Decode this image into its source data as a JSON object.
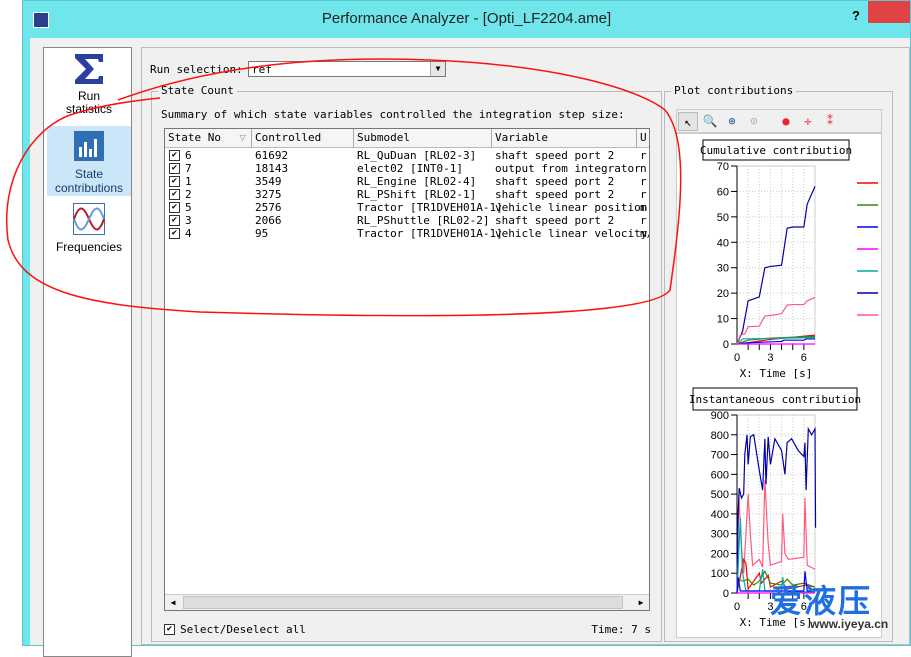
{
  "window": {
    "title": "Performance Analyzer - [Opti_LF2204.ame]",
    "help": "?"
  },
  "sidebar": {
    "items": [
      {
        "label_lines": [
          "Run",
          "statistics"
        ],
        "icon": "sigma-icon",
        "selected": false
      },
      {
        "label_lines": [
          "State",
          "contributions"
        ],
        "icon": "bar-chart-icon",
        "selected": true
      },
      {
        "label_lines": [
          "Frequencies"
        ],
        "icon": "waveform-icon",
        "selected": false
      }
    ]
  },
  "run_selection": {
    "label": "Run selection:",
    "value": "ref"
  },
  "state_count": {
    "group_title": "State Count",
    "summary": "Summary of which state variables controlled the integration step size:",
    "columns": [
      "State No",
      "Controlled",
      "Submodel",
      "Variable",
      "U"
    ],
    "rows": [
      {
        "checked": true,
        "state_no": "6",
        "controlled": "61692",
        "submodel": "RL_QuDuan [RL02-3]",
        "variable": "shaft speed port 2",
        "unit": "r"
      },
      {
        "checked": true,
        "state_no": "7",
        "controlled": "18143",
        "submodel": "elect02 [INT0-1]",
        "variable": "output from integrator",
        "unit": "n"
      },
      {
        "checked": true,
        "state_no": "1",
        "controlled": "3549",
        "submodel": "RL_Engine [RL02-4]",
        "variable": "shaft speed port 2",
        "unit": "r"
      },
      {
        "checked": true,
        "state_no": "2",
        "controlled": "3275",
        "submodel": "RL_PShift [RL02-1]",
        "variable": "shaft speed port 2",
        "unit": "r"
      },
      {
        "checked": true,
        "state_no": "5",
        "controlled": "2576",
        "submodel": "Tractor [TR1DVEH01A-1]",
        "variable": "vehicle linear position",
        "unit": "m"
      },
      {
        "checked": true,
        "state_no": "3",
        "controlled": "2066",
        "submodel": "RL_PShuttle [RL02-2]",
        "variable": "shaft speed port 2",
        "unit": "r"
      },
      {
        "checked": true,
        "state_no": "4",
        "controlled": "95",
        "submodel": "Tractor [TR1DVEH01A-1]",
        "variable": "vehicle linear velocity",
        "unit": "m/"
      }
    ],
    "select_all_label": "Select/Deselect all",
    "select_all_checked": true,
    "time_label": "Time: 7 s"
  },
  "plot": {
    "group_title": "Plot contributions",
    "toolbar": [
      "pointer-icon",
      "zoom-icon",
      "zoom-fit-icon",
      "zoom-reset-icon",
      "marker-icon",
      "crosshair-marker-icon",
      "double-marker-icon"
    ]
  },
  "chart_data": [
    {
      "type": "line",
      "title": "Cumulative contribution",
      "xlabel": "X: Time [s]",
      "xlim": [
        0,
        7
      ],
      "ylim": [
        0,
        70
      ],
      "xticks": [
        "0",
        "3",
        "6"
      ],
      "yticks": [
        "0",
        "10",
        "20",
        "30",
        "40",
        "50",
        "60",
        "70"
      ],
      "grid": true,
      "series": [
        {
          "color": "#ff0000",
          "points": [
            [
              0,
              0
            ],
            [
              1,
              0.5
            ],
            [
              3,
              1.8
            ],
            [
              7,
              3.5
            ]
          ]
        },
        {
          "color": "#3a8a00",
          "points": [
            [
              0,
              0
            ],
            [
              1,
              1.5
            ],
            [
              3,
              2.3
            ],
            [
              7,
              3
            ]
          ]
        },
        {
          "color": "#0000ff",
          "points": [
            [
              0,
              0
            ],
            [
              1,
              0.5
            ],
            [
              4,
              1
            ],
            [
              4.2,
              1.5
            ],
            [
              6,
              1.5
            ],
            [
              6.2,
              2
            ],
            [
              7,
              2
            ]
          ]
        },
        {
          "color": "#ff00ff",
          "points": [
            [
              0,
              0
            ],
            [
              7,
              0
            ]
          ]
        },
        {
          "color": "#00aaaa",
          "points": [
            [
              0,
              0
            ],
            [
              0.5,
              2
            ],
            [
              3,
              2.2
            ],
            [
              7,
              2.5
            ]
          ]
        },
        {
          "color": "#0000aa",
          "points": [
            [
              0,
              0
            ],
            [
              0.5,
              5
            ],
            [
              1,
              17
            ],
            [
              2,
              18.5
            ],
            [
              2.5,
              30
            ],
            [
              3,
              30.5
            ],
            [
              4,
              31
            ],
            [
              4.5,
              45.5
            ],
            [
              5,
              46
            ],
            [
              6,
              46
            ],
            [
              6.3,
              55
            ],
            [
              7,
              62
            ]
          ]
        },
        {
          "color": "#ff5a80",
          "points": [
            [
              0,
              0
            ],
            [
              0.3,
              3.5
            ],
            [
              0.7,
              4
            ],
            [
              1,
              6.8
            ],
            [
              2,
              7
            ],
            [
              2.5,
              11
            ],
            [
              3.5,
              11.5
            ],
            [
              4,
              12
            ],
            [
              4.5,
              15.3
            ],
            [
              5,
              15.5
            ],
            [
              6,
              15.5
            ],
            [
              6.3,
              17
            ],
            [
              7,
              18.3
            ]
          ]
        }
      ]
    },
    {
      "type": "line",
      "title": "Instantaneous contribution",
      "xlabel": "X: Time [s]",
      "xlim": [
        0,
        7
      ],
      "ylim": [
        0,
        900
      ],
      "xticks": [
        "0",
        "3",
        "6"
      ],
      "yticks": [
        "0",
        "100",
        "200",
        "300",
        "400",
        "500",
        "600",
        "700",
        "800",
        "900"
      ],
      "grid": true,
      "series": [
        {
          "color": "#ff5a80",
          "points": [
            [
              0,
              0
            ],
            [
              0.15,
              500
            ],
            [
              0.4,
              230
            ],
            [
              0.6,
              100
            ],
            [
              1,
              500
            ],
            [
              1.2,
              300
            ],
            [
              1.4,
              140
            ],
            [
              2,
              170
            ],
            [
              2.3,
              130
            ],
            [
              2.5,
              570
            ],
            [
              2.8,
              250
            ],
            [
              3,
              140
            ],
            [
              4,
              160
            ],
            [
              4.1,
              400
            ],
            [
              4.3,
              200
            ],
            [
              4.6,
              170
            ],
            [
              6,
              180
            ],
            [
              6.1,
              480
            ],
            [
              6.3,
              140
            ],
            [
              7,
              120
            ]
          ]
        },
        {
          "color": "#0000aa",
          "points": [
            [
              0,
              0
            ],
            [
              0.1,
              400
            ],
            [
              0.2,
              530
            ],
            [
              0.4,
              480
            ],
            [
              0.6,
              500
            ],
            [
              0.7,
              700
            ],
            [
              0.9,
              800
            ],
            [
              1,
              650
            ],
            [
              1.2,
              790
            ],
            [
              1.5,
              800
            ],
            [
              2,
              620
            ],
            [
              2.3,
              520
            ],
            [
              2.5,
              780
            ],
            [
              2.6,
              550
            ],
            [
              2.8,
              790
            ],
            [
              3,
              650
            ],
            [
              3.4,
              780
            ],
            [
              4,
              720
            ],
            [
              4.3,
              600
            ],
            [
              4.5,
              760
            ],
            [
              4.9,
              780
            ],
            [
              5.5,
              720
            ],
            [
              6,
              690
            ],
            [
              6.1,
              760
            ],
            [
              6.2,
              520
            ],
            [
              6.4,
              830
            ],
            [
              6.7,
              800
            ],
            [
              7,
              830
            ],
            [
              7.05,
              330
            ]
          ]
        },
        {
          "color": "#ff0000",
          "points": [
            [
              0,
              0
            ],
            [
              0.6,
              170
            ],
            [
              0.8,
              150
            ],
            [
              1,
              20
            ],
            [
              2,
              100
            ],
            [
              2.2,
              50
            ],
            [
              2.8,
              90
            ],
            [
              3,
              30
            ],
            [
              4,
              60
            ],
            [
              4.5,
              20
            ],
            [
              6.2,
              40
            ],
            [
              7,
              30
            ]
          ]
        },
        {
          "color": "#3a8a00",
          "points": [
            [
              0,
              0
            ],
            [
              0.2,
              70
            ],
            [
              0.5,
              60
            ],
            [
              1,
              70
            ],
            [
              1.5,
              40
            ],
            [
              2,
              60
            ],
            [
              2.5,
              110
            ],
            [
              3,
              50
            ],
            [
              4,
              40
            ],
            [
              4.5,
              70
            ],
            [
              5,
              40
            ],
            [
              6,
              50
            ],
            [
              7,
              30
            ]
          ]
        },
        {
          "color": "#00aaaa",
          "points": [
            [
              0,
              0
            ],
            [
              0.3,
              380
            ],
            [
              0.5,
              100
            ],
            [
              0.8,
              10
            ],
            [
              2,
              10
            ],
            [
              2.3,
              120
            ],
            [
              2.5,
              10
            ],
            [
              4,
              10
            ],
            [
              4.1,
              80
            ],
            [
              4.3,
              5
            ],
            [
              7,
              5
            ]
          ]
        },
        {
          "color": "#0000ff",
          "points": [
            [
              0,
              0
            ],
            [
              0.1,
              80
            ],
            [
              0.3,
              10
            ],
            [
              6,
              10
            ],
            [
              6.1,
              110
            ],
            [
              6.3,
              10
            ],
            [
              7,
              10
            ]
          ]
        },
        {
          "color": "#ff00ff",
          "points": [
            [
              0,
              0
            ],
            [
              7,
              0
            ]
          ]
        }
      ]
    }
  ],
  "watermark": {
    "main": "爱液压",
    "url": "www.iyeya.cn"
  },
  "colors": {
    "titlebar": "#6ee6ec",
    "annotation": "#ff0000",
    "selected": "#cbe6f9"
  }
}
